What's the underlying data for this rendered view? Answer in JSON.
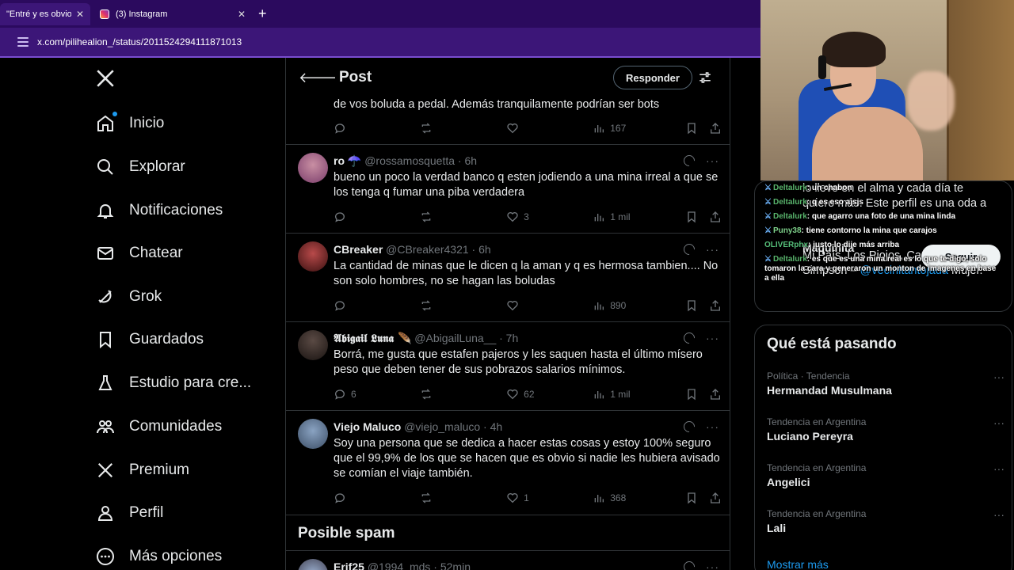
{
  "browser": {
    "tabs": [
      {
        "title": "\"Entré y es obvio q",
        "active": true
      },
      {
        "title": "(3) Instagram",
        "active": false
      }
    ],
    "new_tab": "+",
    "url": "x.com/pilihealion_/status/2011524294111871013"
  },
  "nav": {
    "items": [
      {
        "label": "Inicio",
        "icon": "home-icon"
      },
      {
        "label": "Explorar",
        "icon": "search-icon"
      },
      {
        "label": "Notificaciones",
        "icon": "bell-icon"
      },
      {
        "label": "Chatear",
        "icon": "mail-icon"
      },
      {
        "label": "Grok",
        "icon": "grok-icon"
      },
      {
        "label": "Guardados",
        "icon": "bookmark-icon"
      },
      {
        "label": "Estudio para cre...",
        "icon": "creator-studio-icon"
      },
      {
        "label": "Comunidades",
        "icon": "communities-icon"
      },
      {
        "label": "Premium",
        "icon": "x-premium-icon"
      },
      {
        "label": "Perfil",
        "icon": "profile-icon"
      },
      {
        "label": "Más opciones",
        "icon": "more-options-icon"
      }
    ]
  },
  "post": {
    "title": "Post",
    "reply_label": "Responder",
    "partial_tweet": {
      "text": "de vos boluda a pedal. Además tranquilamente podrían ser bots",
      "views": "167"
    },
    "tweets": [
      {
        "name": "ro ☂️",
        "meta": "@rossamosquetta · 6h",
        "text": "bueno un poco la verdad banco q esten jodiendo a una mina irreal a que se los tenga q fumar una piba verdadera",
        "replies": "",
        "likes": "3",
        "views": "1 mil"
      },
      {
        "name": "CBreaker",
        "meta": "@CBreaker4321 · 6h",
        "text": "La cantidad de minas que le dicen q la aman y q es hermosa tambien.... No son solo hombres, no se hagan las boludas",
        "replies": "",
        "likes": "",
        "views": "890"
      },
      {
        "name": "𝕬𝖇𝖎𝖌𝖆𝖎𝖑 𝕷𝖚𝖓𝖆 🪶",
        "meta": "@AbigailLuna__ · 7h",
        "text": "Borrá, me gusta que estafen pajeros y les saquen hasta el último mísero peso que deben tener de sus pobrazos salarios mínimos.",
        "replies": "6",
        "likes": "62",
        "views": "1 mil"
      },
      {
        "name": "Viejo Maluco",
        "meta": "@viejo_maluco · 4h",
        "text": "Soy una persona que se dedica a hacer estas cosas y estoy 100% seguro que el 99,9% de los que se hacen que es obvio si nadie les hubiera avisado se comían el viaje también.",
        "replies": "",
        "likes": "1",
        "views": "368"
      }
    ],
    "spam_title": "Posible spam",
    "spam_tweet": {
      "name": "Erif25",
      "meta": "@1994_mds · 52min"
    }
  },
  "who": {
    "bio_line1": "lo llevo en el alma y cada día te",
    "bio_line2": "quiero más. Este perfil es una oda a",
    "name": "Maquinita",
    "bio_line4": "Mi País, Los Piojos, Capusotto y los",
    "bio_line5_pre": "Simpson – ",
    "bio_mention": "@vecinitantojada",
    "bio_line5_post": " Mujer.",
    "follow_label": "Seguir"
  },
  "trends": {
    "title": "Qué está pasando",
    "items": [
      {
        "category": "Política · Tendencia",
        "name": "Hermandad Musulmana"
      },
      {
        "category": "Tendencia en Argentina",
        "name": "Luciano Pereyra"
      },
      {
        "category": "Tendencia en Argentina",
        "name": "Angelici"
      },
      {
        "category": "Tendencia en Argentina",
        "name": "Lali"
      }
    ],
    "show_more": "Mostrar más"
  },
  "chat": [
    {
      "user": "Deltalurk",
      "text": "un chabon"
    },
    {
      "user": "Deltalurk",
      "text": "q es eso ajsjs"
    },
    {
      "user": "Deltalurk",
      "text": "que agarro una foto de una mina linda"
    },
    {
      "user": "Puny38",
      "text": "tiene contorno la mina que carajos"
    },
    {
      "user": "OLIVERphx",
      "text": "justo lo dije más arriba"
    },
    {
      "user": "Deltalurk",
      "text": "es que es una mina real es lo que te digo, solo tomaron la cara y generaron un monton de imagenes en base a ella"
    }
  ],
  "colors": {
    "accent": "#1d9bf0",
    "browser": "#3c1678",
    "border": "#2f3336",
    "muted": "#71767b"
  }
}
